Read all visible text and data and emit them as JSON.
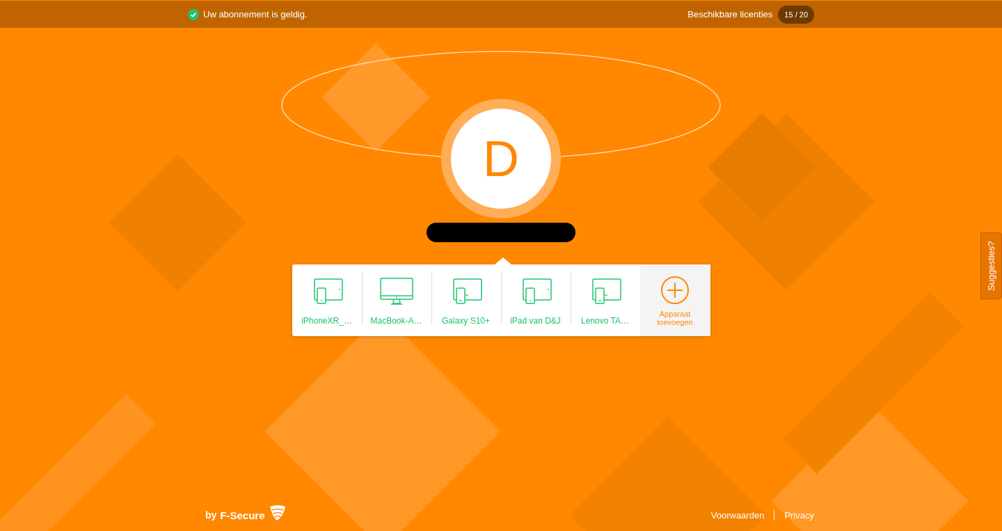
{
  "top_bar": {
    "status": "Uw abonnement is geldig.",
    "status_ok": true,
    "licenses_label": "Beschikbare licenties",
    "licenses_count": "15 / 20"
  },
  "profile": {
    "initial": "D",
    "name_redacted": true
  },
  "devices": [
    {
      "name": "iPhoneXR_…",
      "kind": "tablet_phone"
    },
    {
      "name": "MacBook-A…",
      "kind": "desktop"
    },
    {
      "name": "Galaxy S10+",
      "kind": "tablet_android"
    },
    {
      "name": "iPad van D&J",
      "kind": "tablet_phone"
    },
    {
      "name": "Lenovo TA…",
      "kind": "tablet_android"
    }
  ],
  "add_device": "Apparaat toevoegen",
  "feedback_tab": "Suggesties?",
  "footer": {
    "brand_prefix": "by",
    "brand": "F-Secure",
    "links": [
      "Voorwaarden",
      "Privacy"
    ]
  }
}
